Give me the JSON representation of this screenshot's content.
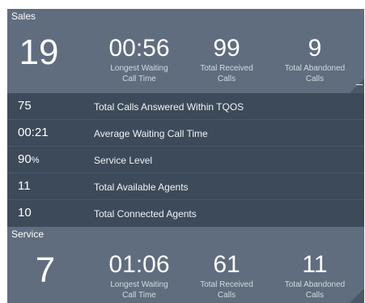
{
  "sales": {
    "name": "Sales",
    "queued": "19",
    "stats": [
      {
        "value": "00:56",
        "label_line1": "Longest Waiting",
        "label_line2": "Call Time"
      },
      {
        "value": "99",
        "label_line1": "Total Received",
        "label_line2": "Calls"
      },
      {
        "value": "9",
        "label_line1": "Total Abandoned",
        "label_line2": "Calls"
      }
    ],
    "details": [
      {
        "value": "75",
        "unit": "",
        "label": "Total Calls Answered Within TQOS"
      },
      {
        "value": "00:21",
        "unit": "",
        "label": "Average Waiting Call Time"
      },
      {
        "value": "90",
        "unit": "%",
        "label": "Service Level"
      },
      {
        "value": "11",
        "unit": "",
        "label": "Total Available Agents"
      },
      {
        "value": "10",
        "unit": "",
        "label": "Total Connected Agents"
      }
    ]
  },
  "service": {
    "name": "Service",
    "queued": "7",
    "stats": [
      {
        "value": "01:06",
        "label_line1": "Longest Waiting",
        "label_line2": "Call Time"
      },
      {
        "value": "61",
        "label_line1": "Total Received",
        "label_line2": "Calls"
      },
      {
        "value": "11",
        "label_line1": "Total Abandoned",
        "label_line2": "Calls"
      }
    ]
  },
  "colors": {
    "panel": "#5f6d7e",
    "details": "#3d4a59",
    "label": "#d4dae2"
  }
}
